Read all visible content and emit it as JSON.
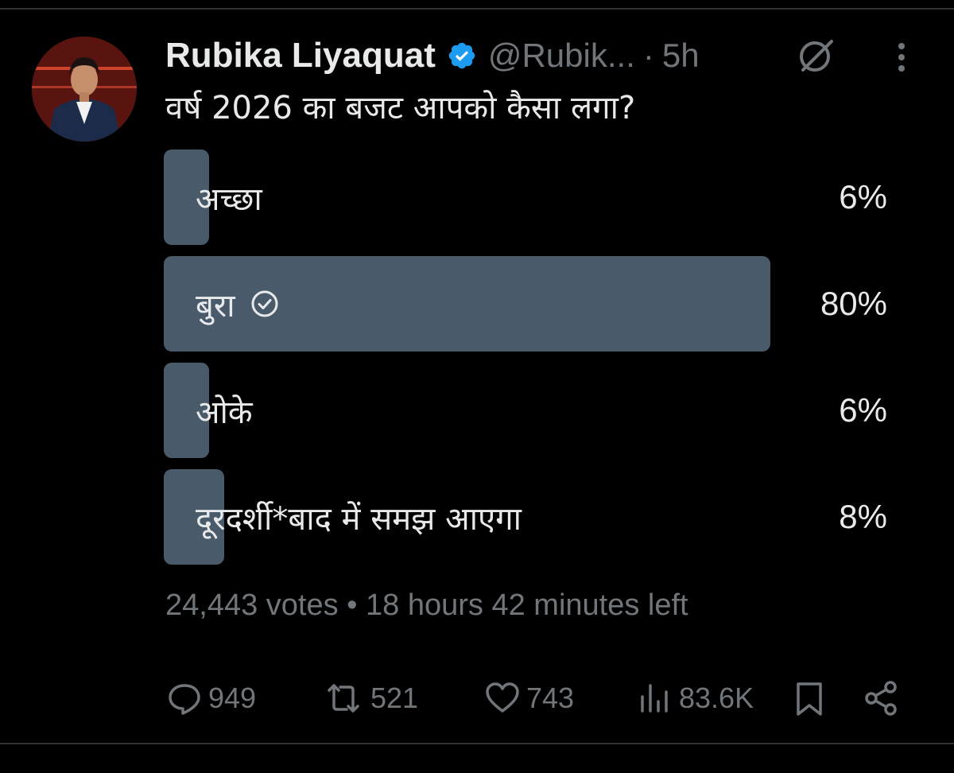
{
  "tweet": {
    "author_name": "Rubika Liyaquat",
    "handle": "@Rubik...",
    "separator": "·",
    "time": "5h",
    "text": "वर्ष 2026 का बजट आपको कैसा लगा?"
  },
  "poll": {
    "options": [
      {
        "label": "अच्छा",
        "percent_text": "6%",
        "percent": 6,
        "selected": false
      },
      {
        "label": "बुरा",
        "percent_text": "80%",
        "percent": 80,
        "selected": true
      },
      {
        "label": "ओके",
        "percent_text": "6%",
        "percent": 6,
        "selected": false
      },
      {
        "label": "दूरदर्शी*बाद में समझ आएगा",
        "percent_text": "8%",
        "percent": 8,
        "selected": false
      }
    ],
    "meta": "24,443 votes • 18 hours 42 minutes left"
  },
  "actions": {
    "replies": "949",
    "reposts": "521",
    "likes": "743",
    "views": "83.6K"
  },
  "colors": {
    "background": "#000000",
    "bar": "#495a6b",
    "muted_text": "#71767b",
    "primary_text": "#e7e9ea",
    "verified_blue": "#1d9bf0"
  },
  "icons": [
    "verified-badge-icon",
    "grok-icon",
    "more-options-icon",
    "check-circle-icon",
    "reply-icon",
    "repost-icon",
    "like-icon",
    "views-icon",
    "bookmark-icon",
    "share-icon"
  ]
}
